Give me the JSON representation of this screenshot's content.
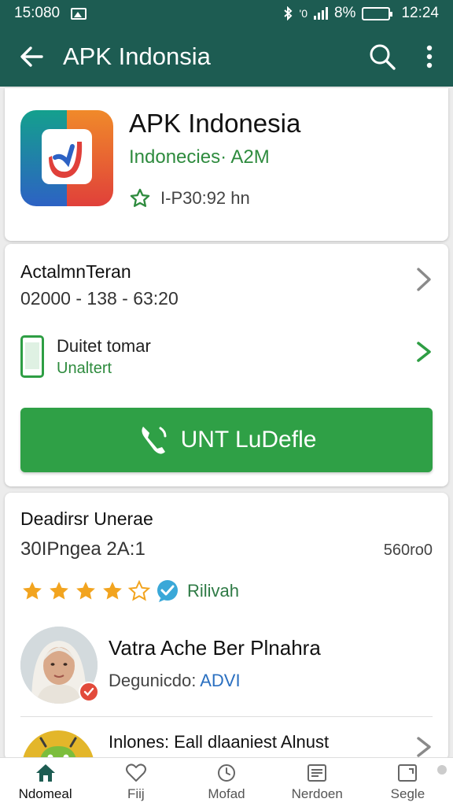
{
  "status_bar": {
    "time": "15:080",
    "right_text": "8%",
    "signal_text": "'0",
    "clock": "12:24"
  },
  "app_bar": {
    "title": "APK Indonsia",
    "back_icon": "arrow-left-icon",
    "search_icon": "search-icon",
    "more_icon": "more-vert-icon"
  },
  "app_info": {
    "name": "APK Indonesia",
    "developer": "Indonecies· A2M",
    "rating_text": "I-P30:92 hn",
    "icon": "app-logo-icon"
  },
  "details": {
    "title": "ActalmnTeran",
    "date": "02000 - 138 - 63:20",
    "device_title": "Duitet tomar",
    "device_status": "Unaltert",
    "install_label": "UNT LuDefle"
  },
  "reviews": {
    "title": "Deadirsr Unerae",
    "subtitle": "30IPngea 2A:1",
    "count": "560ro0",
    "rating": 4,
    "max_rating": 5,
    "badge_label": "Rilivah",
    "reviewer_name": "Vatra Ache Ber Plnahra",
    "reviewer_meta_prefix": "Degunicdo:",
    "reviewer_meta_value": "ADVI",
    "next_item_label": "Inlones: Eall dlaaniest Alnust"
  },
  "bottom_nav": [
    {
      "label": "Ndomeal",
      "icon": "home-icon",
      "active": true
    },
    {
      "label": "Fiij",
      "icon": "heart-icon",
      "active": false
    },
    {
      "label": "Mofad",
      "icon": "clock-icon",
      "active": false
    },
    {
      "label": "Nerdoen",
      "icon": "list-icon",
      "active": false
    },
    {
      "label": "Segle",
      "icon": "tablet-icon",
      "active": false
    }
  ],
  "colors": {
    "app_bar": "#1d5c52",
    "accent_green": "#2fa046",
    "star": "#f2a41f"
  }
}
